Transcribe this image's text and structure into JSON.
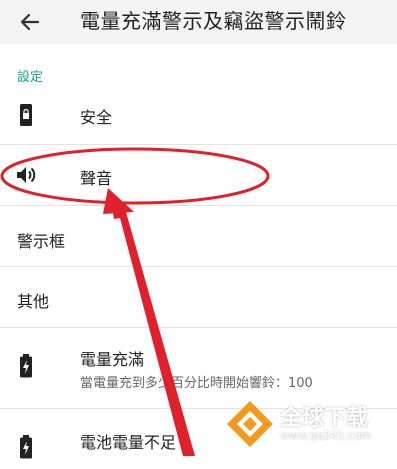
{
  "appbar": {
    "title": "電量充滿警示及竊盜警示鬧鈴",
    "back_icon": "arrow-left-icon"
  },
  "settings": {
    "section_label": "設定",
    "items": [
      {
        "title": "安全",
        "icon": "phone-lock-icon"
      },
      {
        "title": "聲音",
        "icon": "speaker-icon"
      },
      {
        "title": "警示框"
      },
      {
        "title": "其他"
      },
      {
        "title": "電量充滿",
        "summary": "當電量充到多少百分比時開始響鈴：100",
        "icon": "battery-charging-icon"
      },
      {
        "title": "電池電量不足",
        "icon": "battery-charging-icon"
      }
    ]
  },
  "annotation": {
    "color": "#e0202a",
    "circle_target": "聲音"
  },
  "watermark": {
    "logo": "qq241-logo-icon",
    "text": "全球下载",
    "url": "www.qq241.com",
    "color": "#f39a1e"
  }
}
